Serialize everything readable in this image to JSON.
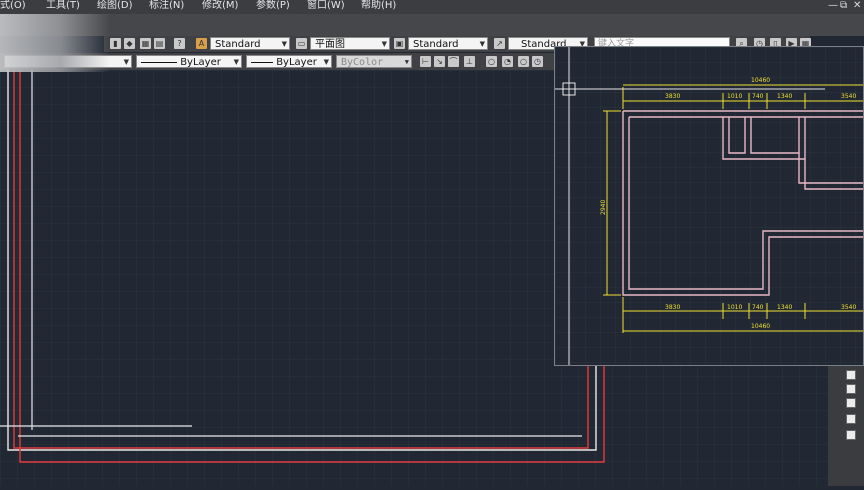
{
  "menu": [
    "式(O)",
    "工具(T)",
    "绘图(D)",
    "标注(N)",
    "修改(M)",
    "参数(P)",
    "窗口(W)",
    "帮助(H)"
  ],
  "window_controls": {
    "minimize": "—",
    "restore": "⧉",
    "close": "✕"
  },
  "toolbar1": {
    "text_style": "Standard",
    "view": "平面图",
    "dim_style": "Standard",
    "multileader_style": "Standard",
    "search_placeholder": "键入文字"
  },
  "toolbar2": {
    "layer": "",
    "linetype": "ByLayer",
    "lineweight": "ByLayer",
    "plot_style": "ByColor"
  },
  "drawing": {
    "dimensions_top": {
      "overall": "10460",
      "segments": [
        "3830",
        "1010",
        "740",
        "1340",
        "3540"
      ]
    },
    "dimensions_bottom": {
      "overall": "10460",
      "segments": [
        "3830",
        "1010",
        "740",
        "1340",
        "3540"
      ]
    },
    "dimension_left": "2940"
  },
  "colors": {
    "canvas": "#212833",
    "grid": "#2c3441",
    "wall": "#e23c3c",
    "dimension": "#f0e034",
    "line": "#e8e8e8"
  }
}
